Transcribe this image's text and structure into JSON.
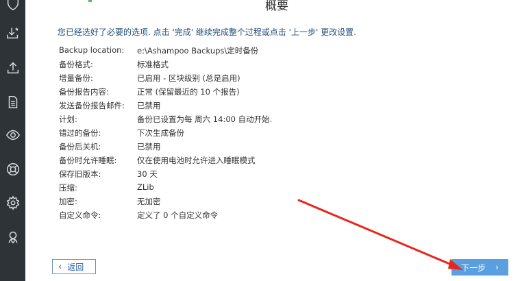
{
  "header": {
    "title": "概要"
  },
  "intro_text": "您已经选好了必要的选项. 点击 '完成' 继续完成整个过程或点击 '上一步' 更改设置.",
  "summary": [
    {
      "key": "Backup location:",
      "value": "e:\\Ashampoo Backups\\定时备份"
    },
    {
      "key": "备份格式:",
      "value": "标准格式"
    },
    {
      "key": "增量备份:",
      "value": "已启用 - 区块级别 (总是启用)"
    },
    {
      "key": "备份报告内容:",
      "value": "正常 (保留最近的 10 个报告)"
    },
    {
      "key": "发送备份报告邮件:",
      "value": "已禁用"
    },
    {
      "key": "计划:",
      "value": "备份已设置为每 周六 14:00 自动开始."
    },
    {
      "key": "错过的备份:",
      "value": "下次生成备份"
    },
    {
      "key": "备份后关机:",
      "value": "已禁用"
    },
    {
      "key": "备份时允许睡眠:",
      "value": "仅在使用电池时允许进入睡眠模式"
    },
    {
      "key": "保存旧版本:",
      "value": "30 天"
    },
    {
      "key": "压缩:",
      "value": "ZLib"
    },
    {
      "key": "加密:",
      "value": "无加密"
    },
    {
      "key": "自定义命令:",
      "value": "定义了 0 个自定义命令"
    }
  ],
  "buttons": {
    "back_label": "返回",
    "back_chevron": "‹",
    "next_label": "下一步",
    "next_chevron": "›"
  },
  "colors": {
    "sidebar": "#2e3338",
    "accent": "#5a9fe0",
    "intro_text": "#1f4e79",
    "annotation_arrow": "#e8261c"
  },
  "sidebar_icons": [
    "shield-icon",
    "download-star-icon",
    "upload-icon",
    "document-icon",
    "eye-icon",
    "lifebuoy-icon",
    "gear-icon",
    "user-support-icon"
  ]
}
